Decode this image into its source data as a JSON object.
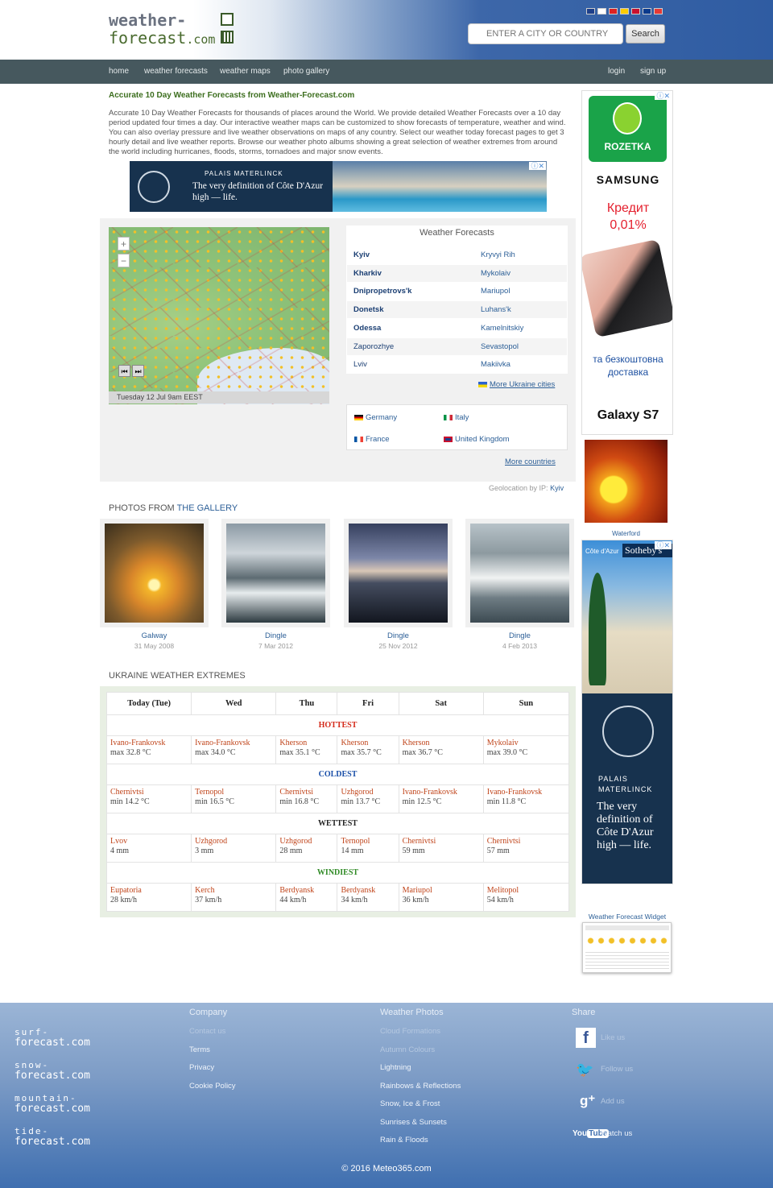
{
  "header": {
    "logo_top": "weather-",
    "logo_bottom": "forecast",
    "logo_suffix": ".com",
    "search_placeholder": "ENTER A CITY OR COUNTRY",
    "search_button": "Search",
    "flag_colors": [
      "#1d3f8a",
      "#ffffff",
      "#dd2222",
      "#ffcc00",
      "#c8102e",
      "#0a3a8c",
      "#e53935"
    ]
  },
  "nav": {
    "home": "home",
    "forecasts": "weather forecasts",
    "maps": "weather maps",
    "gallery": "photo gallery",
    "login": "login",
    "signup": "sign up"
  },
  "intro": {
    "title": "Accurate 10 Day Weather Forecasts from Weather-Forecast.com",
    "text": "Accurate 10 Day Weather Forecasts for thousands of places around the World. We provide detailed Weather Forecasts over a 10 day period updated four times a day. Our interactive weather maps can be customized to show forecasts of temperature, weather and wind. You can also overlay pressure and live weather observations on maps of any country. Select our weather today forecast pages to get 3 hourly detail and live weather reports. Browse our weather photo albums showing a great selection of weather extremes from around the world including hurricanes, floods, storms, tornadoes and major snow events."
  },
  "ad_banner": {
    "brand": "PALAIS MATERLINCK",
    "slogan": "The very definition of Côte D'Azur high — life."
  },
  "map": {
    "zoom_in": "+",
    "zoom_out": "−",
    "timestamp": "Tuesday 12 Jul 9am EEST"
  },
  "weather_forecasts": {
    "title": "Weather Forecasts",
    "rows": [
      {
        "left": "Kyiv",
        "right": "Kryvyi Rih"
      },
      {
        "left": "Kharkiv",
        "right": "Mykolaiv"
      },
      {
        "left": "Dnipropetrovs'k",
        "right": "Mariupol"
      },
      {
        "left": "Donetsk",
        "right": "Luhans'k"
      },
      {
        "left": "Odessa",
        "right": "Kamelnitskiy"
      },
      {
        "left": "Zaporozhye",
        "right": "Sevastopol"
      },
      {
        "left": "Lviv",
        "right": "Makiivka"
      }
    ],
    "more_cities": "More Ukraine cities",
    "countries": [
      "Germany",
      "Italy",
      "France",
      "United Kingdom"
    ],
    "more_countries": "More countries",
    "geo_prefix": "Geolocation by IP:",
    "geo_city": "Kyiv"
  },
  "gallery": {
    "heading_a": "PHOTOS FROM",
    "heading_b": "THE GALLERY",
    "photos": [
      {
        "name": "Galway",
        "date": "31 May 2008"
      },
      {
        "name": "Dingle",
        "date": "7 Mar 2012"
      },
      {
        "name": "Dingle",
        "date": "25 Nov 2012"
      },
      {
        "name": "Dingle",
        "date": "4 Feb 2013"
      }
    ]
  },
  "extremes": {
    "heading": "UKRAINE WEATHER EXTREMES",
    "days": [
      "Today (Tue)",
      "Wed",
      "Thu",
      "Fri",
      "Sat",
      "Sun"
    ],
    "categories": [
      {
        "name": "HOTTEST",
        "color": "#d42a1a",
        "cells": [
          {
            "place": "Ivano-Frankovsk",
            "value": "max 32.8 °C"
          },
          {
            "place": "Ivano-Frankovsk",
            "value": "max 34.0 °C"
          },
          {
            "place": "Kherson",
            "value": "max 35.1 °C"
          },
          {
            "place": "Kherson",
            "value": "max 35.7 °C"
          },
          {
            "place": "Kherson",
            "value": "max 36.7 °C"
          },
          {
            "place": "Mykolaiv",
            "value": "max 39.0 °C"
          }
        ]
      },
      {
        "name": "COLDEST",
        "color": "#1a4fa8",
        "cells": [
          {
            "place": "Chernivtsi",
            "value": "min 14.2 °C"
          },
          {
            "place": "Ternopol",
            "value": "min 16.5 °C"
          },
          {
            "place": "Chernivtsi",
            "value": "min 16.8 °C"
          },
          {
            "place": "Uzhgorod",
            "value": "min 13.7 °C"
          },
          {
            "place": "Ivano-Frankovsk",
            "value": "min 12.5 °C"
          },
          {
            "place": "Ivano-Frankovsk",
            "value": "min 11.8 °C"
          }
        ]
      },
      {
        "name": "WETTEST",
        "color": "#222222",
        "cells": [
          {
            "place": "Lvov",
            "value": "4 mm"
          },
          {
            "place": "Uzhgorod",
            "value": "3 mm"
          },
          {
            "place": "Uzhgorod",
            "value": "28 mm"
          },
          {
            "place": "Ternopol",
            "value": "14 mm"
          },
          {
            "place": "Chernivtsi",
            "value": "59 mm"
          },
          {
            "place": "Chernivtsi",
            "value": "57 mm"
          }
        ]
      },
      {
        "name": "WINDIEST",
        "color": "#2f8a25",
        "cells": [
          {
            "place": "Eupatoria",
            "value": "28 km/h"
          },
          {
            "place": "Kerch",
            "value": "37 km/h"
          },
          {
            "place": "Berdyansk",
            "value": "44 km/h"
          },
          {
            "place": "Berdyansk",
            "value": "34 km/h"
          },
          {
            "place": "Mariupol",
            "value": "36 km/h"
          },
          {
            "place": "Melitopol",
            "value": "54 km/h"
          }
        ]
      }
    ]
  },
  "sidebar": {
    "ad1_brand": "ROZETKA",
    "ad1_samsung": "SAMSUNG",
    "ad1_credit": "Кредит",
    "ad1_rate": "0,01%",
    "ad1_delivery": "та безкоштовна доставка",
    "ad1_model": "Galaxy S7",
    "photo_caption": "Waterford",
    "ad2_top": "Côte d'Azur",
    "ad2_sothebys": "Sotheby's",
    "ad2_brand": "PALAIS MATERLINCK",
    "ad2_slogan": "The very definition of Côte D'Azur high — life.",
    "widget_title": "Weather Forecast Widget"
  },
  "footer": {
    "sites": [
      {
        "top": "surf-",
        "bottom": "forecast.com"
      },
      {
        "top": "snow-",
        "bottom": "forecast.com"
      },
      {
        "top": "mountain-",
        "bottom": "forecast.com"
      },
      {
        "top": "tide-",
        "bottom": "forecast.com"
      }
    ],
    "company_head": "Company",
    "company_links": [
      "Contact us",
      "Terms",
      "Privacy",
      "Cookie Policy"
    ],
    "photos_head": "Weather Photos",
    "photos_links": [
      "Cloud Formations",
      "Autumn Colours",
      "Lightning",
      "Rainbows & Reflections",
      "Snow, Ice & Frost",
      "Sunrises & Sunsets",
      "Rain & Floods"
    ],
    "share_head": "Share",
    "share_links": [
      "Like us",
      "Follow us",
      "Add us",
      "Watch us"
    ],
    "copyright": "© 2016 Meteo365.com"
  }
}
